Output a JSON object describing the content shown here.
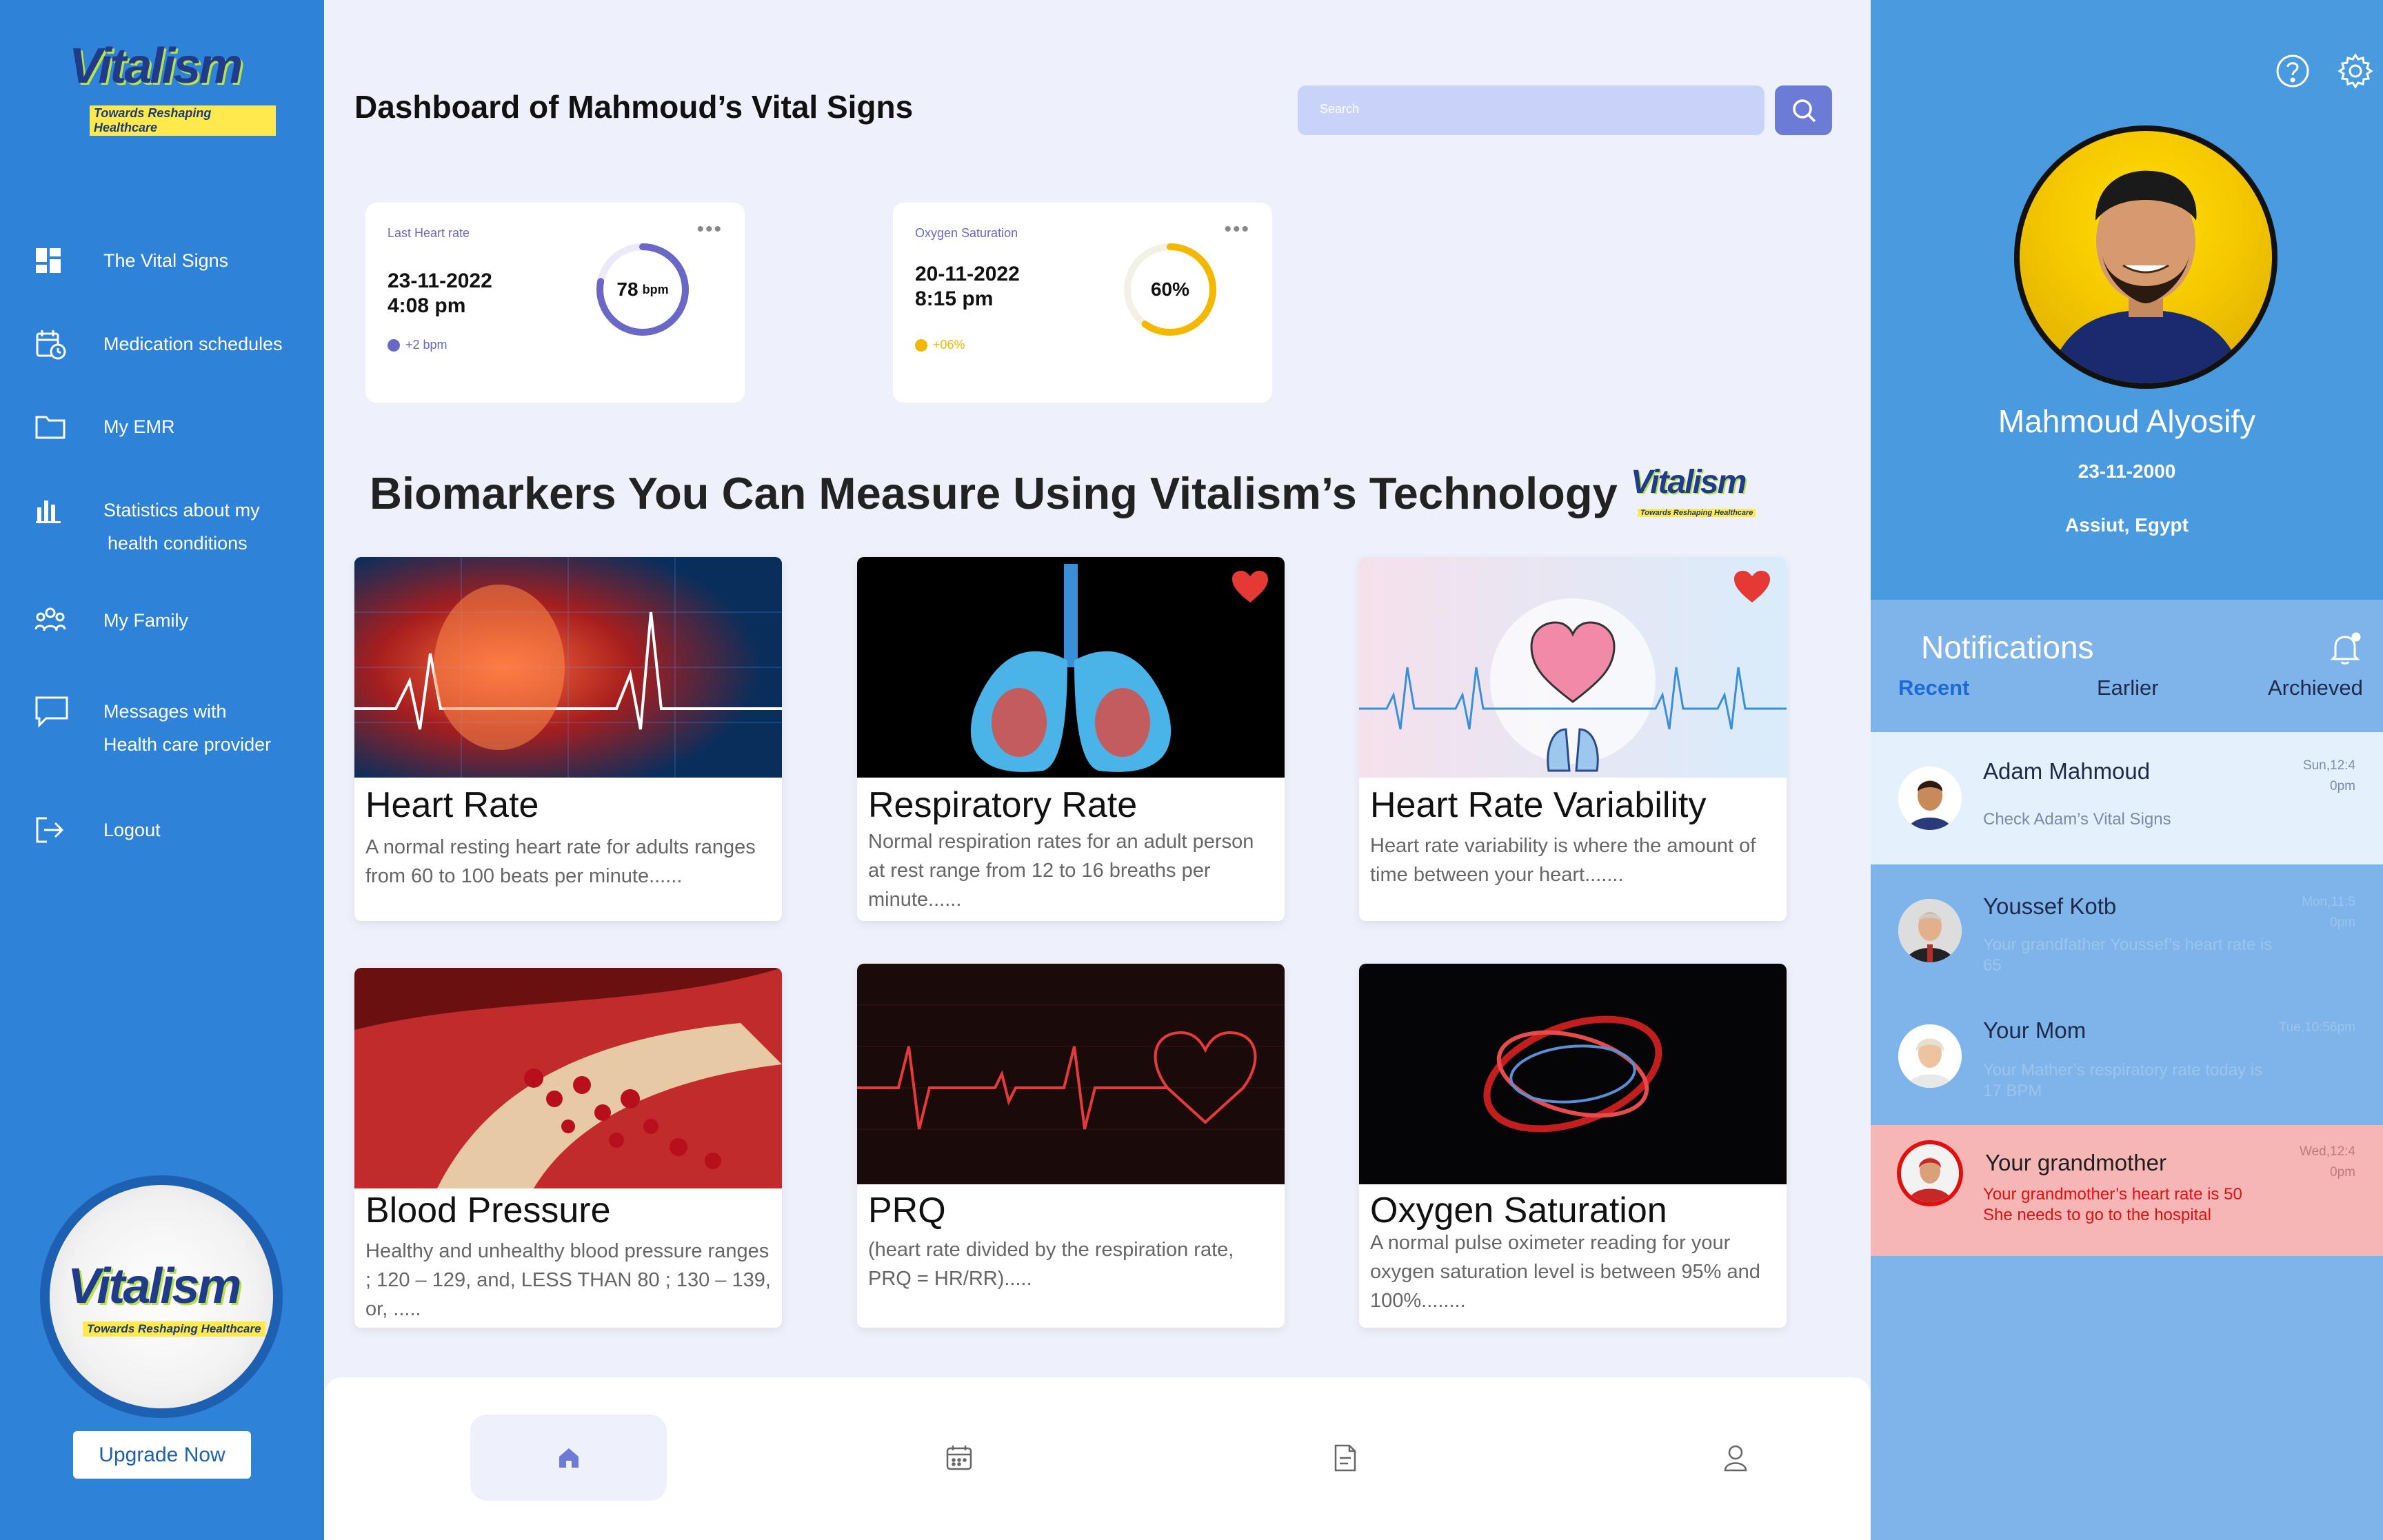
{
  "brand": {
    "logo_text": "Vitalism",
    "tagline": "Towards Reshaping Healthcare"
  },
  "sidebar": {
    "items": [
      {
        "label": "The Vital Signs",
        "icon": "dashboard-grid-icon"
      },
      {
        "label": "Medication schedules",
        "icon": "calendar-clock-icon"
      },
      {
        "label": "My EMR",
        "icon": "folder-icon"
      },
      {
        "label": "Statistics about my",
        "label2": "health conditions",
        "icon": "bar-chart-icon"
      },
      {
        "label": "My Family",
        "icon": "family-icon"
      },
      {
        "label": "Messages with",
        "label2": "Health care provider",
        "icon": "chat-bubble-icon"
      },
      {
        "label": "Logout",
        "icon": "logout-icon"
      }
    ],
    "upgrade_label": "Upgrade Now"
  },
  "header": {
    "title": "Dashboard of Mahmoud’s Vital Signs",
    "search_placeholder": "Search"
  },
  "stats": [
    {
      "title": "Last Heart rate",
      "date": "23-11-2022",
      "time": "4:08 pm",
      "value": "78",
      "unit": "bpm",
      "delta": "+2 bpm",
      "fraction": 0.78,
      "color": "#6b67c7"
    },
    {
      "title": "Oxygen Saturation",
      "date": "20-11-2022",
      "time": "8:15 pm",
      "value": "60%",
      "unit": "",
      "delta": "+06%",
      "fraction": 0.6,
      "color": "#f5b800"
    }
  ],
  "section_title": "Biomarkers You Can Measure Using Vitalism’s Technology",
  "biomarkers": [
    {
      "title": "Heart Rate",
      "desc": "A normal resting heart rate for adults ranges from 60 to 100 beats per minute......",
      "favorite": false
    },
    {
      "title": "Respiratory Rate",
      "desc": "Normal respiration rates for an adult person at rest range from 12 to 16 breaths per minute......",
      "favorite": true
    },
    {
      "title": "Heart Rate Variability",
      "desc": " Heart rate variability is where the amount of time between your heart.......",
      "favorite": true
    },
    {
      "title": "Blood Pressure",
      "desc": "Healthy and unhealthy blood pressure ranges ; 120 – 129, and, LESS THAN 80 ; 130 – 139, or, .....",
      "favorite": false
    },
    {
      "title": "PRQ",
      "desc": "(heart rate divided by the respiration rate, PRQ = HR/RR).....",
      "favorite": false
    },
    {
      "title": "Oxygen Saturation",
      "desc": "A normal pulse oximeter reading for your oxygen saturation level is between 95% and 100%........",
      "favorite": false
    }
  ],
  "bottom_nav": [
    "home-icon",
    "calendar-icon",
    "document-icon",
    "user-icon"
  ],
  "profile": {
    "name": "Mahmoud Alyosify",
    "dob": "23-11-2000",
    "location": "Assiut, Egypt"
  },
  "notifications": {
    "title": "Notifications",
    "tabs": [
      "Recent",
      "Earlier",
      "Archieved"
    ],
    "items": [
      {
        "name": "Adam Mahmoud",
        "message": "Check Adam’s Vital Signs",
        "time1": "Sun,12:4",
        "time2": "0pm",
        "bg": "#e4f0fb"
      },
      {
        "name": "Youssef Kotb",
        "message": "Your grandfather Youssef’s heart rate is 65",
        "time1": "Mon,11:5",
        "time2": "0pm",
        "bg": "transparent"
      },
      {
        "name": "Your Mom",
        "message": "Your Mather’s respiratory rate today is 17 BPM",
        "time1": "Tue,10:56pm",
        "time2": "",
        "bg": "transparent"
      },
      {
        "name": "Your grandmother",
        "message": "Your grandmother’s heart rate is 50",
        "message2": "She needs to go to the hospital",
        "time1": "Wed,12:4",
        "time2": "0pm",
        "bg": "#f6b6b6"
      }
    ]
  }
}
